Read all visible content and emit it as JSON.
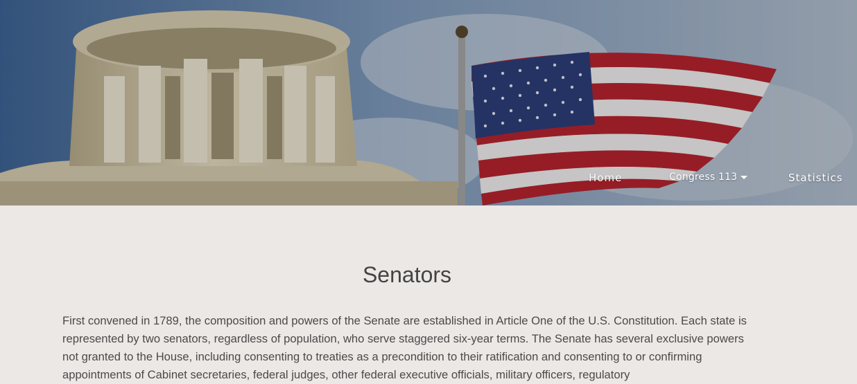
{
  "nav": {
    "home_label": "Home",
    "congress_label": "Congress 113",
    "statistics_label": "Statistics"
  },
  "page": {
    "title": "Senators",
    "intro": "First convened in 1789, the composition and powers of the Senate are established in Article One of the U.S. Constitution. Each state is represented by two senators, regardless of population, who serve staggered six-year terms. The Senate has several exclusive powers not granted to the House, including consenting to treaties as a precondition to their ratification and consenting to or confirming appointments of Cabinet secretaries, federal judges, other federal executive officials, military officers, regulatory"
  },
  "colors": {
    "page_background": "#ece8e6",
    "nav_text": "#ffffff",
    "heading_text": "#444444",
    "body_text": "#4a4a4a"
  }
}
